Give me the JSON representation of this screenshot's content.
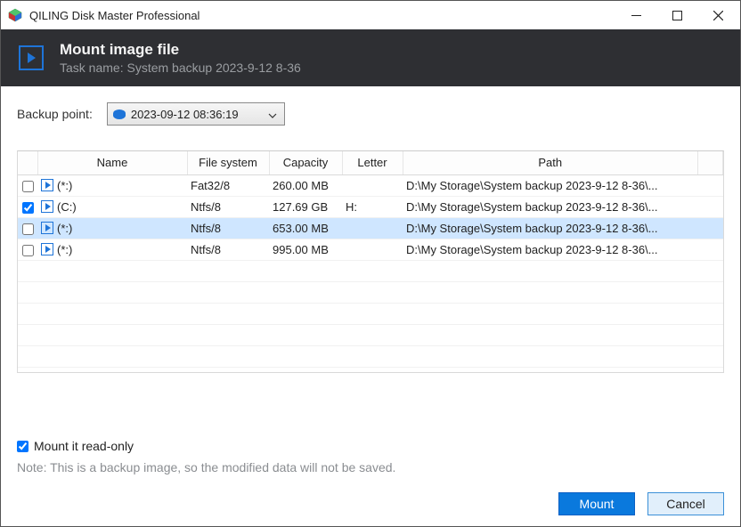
{
  "app": {
    "title": "QILING Disk Master Professional"
  },
  "header": {
    "title": "Mount image file",
    "subtitle": "Task name: System backup 2023-9-12 8-36"
  },
  "backup_point": {
    "label": "Backup point:",
    "selected": "2023-09-12 08:36:19"
  },
  "columns": {
    "name": "Name",
    "fs": "File system",
    "capacity": "Capacity",
    "letter": "Letter",
    "path": "Path"
  },
  "rows": [
    {
      "checked": false,
      "name": "(*:)",
      "fs": "Fat32/8",
      "capacity": "260.00 MB",
      "letter": "",
      "path": "D:\\My Storage\\System backup 2023-9-12 8-36\\...",
      "selected": false
    },
    {
      "checked": true,
      "name": "(C:)",
      "fs": "Ntfs/8",
      "capacity": "127.69 GB",
      "letter": "H:",
      "path": "D:\\My Storage\\System backup 2023-9-12 8-36\\...",
      "selected": false
    },
    {
      "checked": false,
      "name": "(*:)",
      "fs": "Ntfs/8",
      "capacity": "653.00 MB",
      "letter": "",
      "path": "D:\\My Storage\\System backup 2023-9-12 8-36\\...",
      "selected": true
    },
    {
      "checked": false,
      "name": "(*:)",
      "fs": "Ntfs/8",
      "capacity": "995.00 MB",
      "letter": "",
      "path": "D:\\My Storage\\System backup 2023-9-12 8-36\\...",
      "selected": false
    }
  ],
  "readonly": {
    "checked": true,
    "label": "Mount it read-only"
  },
  "note": "Note: This is a backup image, so the modified data will not be saved.",
  "buttons": {
    "mount": "Mount",
    "cancel": "Cancel"
  }
}
